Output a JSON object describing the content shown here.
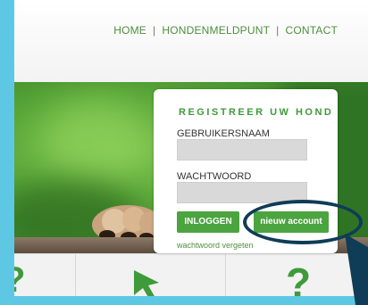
{
  "nav": {
    "home": "HOME",
    "sep1": "|",
    "report": "HONDENMELDPUNT",
    "sep2": "|",
    "contact": "CONTACT"
  },
  "panel": {
    "title": "REGISTREER UW HOND",
    "username_label": "GEBRUIKERSNAAM",
    "password_label": "WACHTWOORD",
    "login_button": "INLOGGEN",
    "new_account_button": "nieuw account",
    "forgot_link": "wachtwoord vergeten"
  },
  "colors": {
    "accent_green": "#4ba43f",
    "annotation": "#0f3c57",
    "frame": "#5ec8e4"
  },
  "icons": {
    "bottom_left": "question-mark-icon",
    "bottom_middle": "cursor-arrow-icon",
    "bottom_right": "question-mark-icon"
  }
}
